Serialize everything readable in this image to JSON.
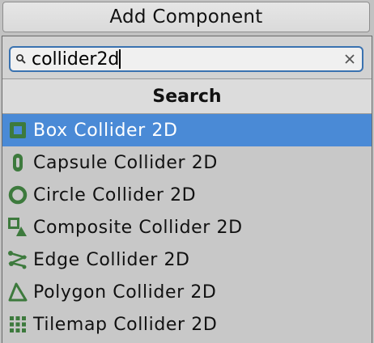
{
  "add_component": {
    "label": "Add Component"
  },
  "search": {
    "value": "collider2d",
    "clear_icon": "close-icon",
    "search_icon": "search-icon"
  },
  "header": {
    "title": "Search"
  },
  "colors": {
    "accent": "#4a8ad6",
    "icon_green": "#3d7a3d",
    "focus_border": "#3a72b0"
  },
  "items": [
    {
      "label": "Box Collider 2D",
      "icon": "box-collider-icon",
      "selected": true
    },
    {
      "label": "Capsule Collider 2D",
      "icon": "capsule-collider-icon",
      "selected": false
    },
    {
      "label": "Circle Collider 2D",
      "icon": "circle-collider-icon",
      "selected": false
    },
    {
      "label": "Composite Collider 2D",
      "icon": "composite-collider-icon",
      "selected": false
    },
    {
      "label": "Edge Collider 2D",
      "icon": "edge-collider-icon",
      "selected": false
    },
    {
      "label": "Polygon Collider 2D",
      "icon": "polygon-collider-icon",
      "selected": false
    },
    {
      "label": "Tilemap Collider 2D",
      "icon": "tilemap-collider-icon",
      "selected": false
    }
  ]
}
